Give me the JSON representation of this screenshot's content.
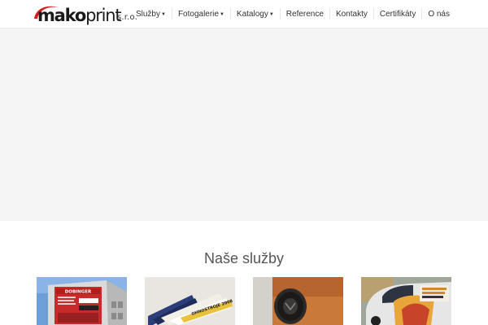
{
  "logo": {
    "mako": "mako",
    "print": "print",
    "sro": "s.r.o."
  },
  "nav": {
    "items": [
      {
        "label": "Služby",
        "has_dropdown": true
      },
      {
        "label": "Fotogalerie",
        "has_dropdown": true
      },
      {
        "label": "Katalogy",
        "has_dropdown": true
      },
      {
        "label": "Reference",
        "has_dropdown": false
      },
      {
        "label": "Kontakty",
        "has_dropdown": false
      },
      {
        "label": "Certifikáty",
        "has_dropdown": false
      },
      {
        "label": "O nás",
        "has_dropdown": false
      }
    ]
  },
  "services": {
    "title": "Naše služby",
    "cards": [
      {
        "name": "building-signage-photo",
        "sign_text": "DOBINGER"
      },
      {
        "name": "tickets-photo",
        "ticket_text": "OHNOSTROJE 2008"
      },
      {
        "name": "stamp-photo"
      },
      {
        "name": "car-wrap-photo"
      }
    ]
  },
  "colors": {
    "brand_red": "#d22020",
    "hero_bg": "#f5f5f5",
    "text": "#333333"
  }
}
